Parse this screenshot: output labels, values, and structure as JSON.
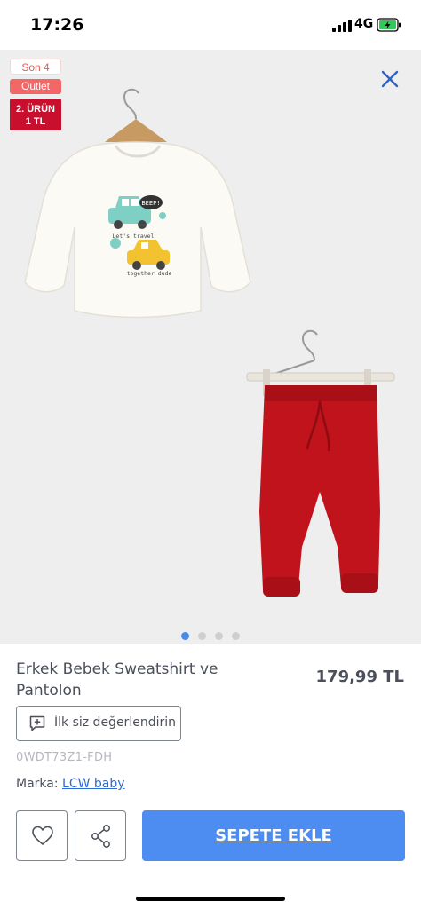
{
  "status_bar": {
    "time": "17:26",
    "network": "4G"
  },
  "badges": {
    "son": "Son 4",
    "outlet": "Outlet",
    "promo": "2. ÜRÜN\n1 TL"
  },
  "gallery": {
    "image_count": 4,
    "active_index": 0,
    "shirt_print": {
      "bubble": "BEEP!",
      "line1": "Let's travel",
      "line2": "together dude"
    }
  },
  "product": {
    "title": "Erkek Bebek Sweatshirt ve Pantolon",
    "price": "179,99 TL",
    "review_label": "İlk siz değerlendirin",
    "sku": "0WDT73Z1-FDH",
    "brand_label": "Marka:",
    "brand_name": "LCW baby"
  },
  "actions": {
    "add_to_cart": "SEPETE EKLE"
  },
  "colors": {
    "accent": "#4d8cf0",
    "close_icon": "#2f62c9",
    "promo_badge": "#c8102e",
    "outlet_badge": "#f46767",
    "pants": "#c0131c"
  },
  "icons": [
    "signal-icon",
    "battery-icon",
    "close-icon",
    "add-review-icon",
    "heart-icon",
    "share-icon"
  ]
}
